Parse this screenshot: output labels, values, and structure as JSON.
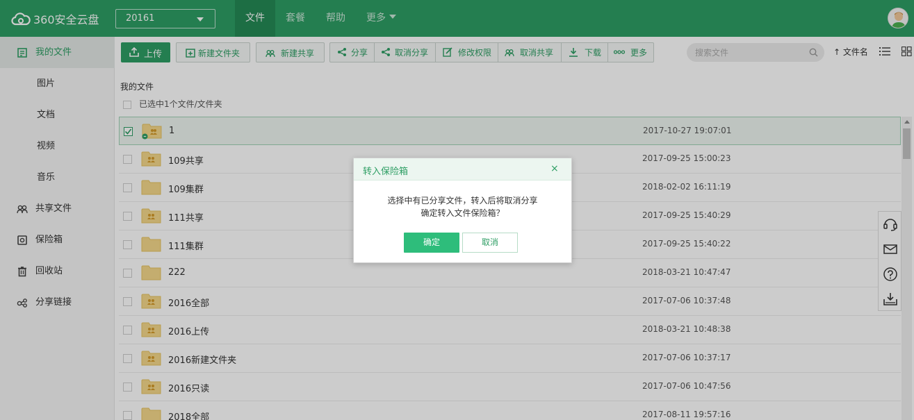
{
  "app": {
    "logo_text": "360安全云盘",
    "account": "20161"
  },
  "nav": [
    {
      "label": "文件"
    },
    {
      "label": "套餐"
    },
    {
      "label": "帮助"
    },
    {
      "label": "更多"
    }
  ],
  "sidebar": {
    "items": [
      {
        "label": "我的文件",
        "icon": "my-files-icon"
      },
      {
        "label": "图片"
      },
      {
        "label": "文档"
      },
      {
        "label": "视频"
      },
      {
        "label": "音乐"
      },
      {
        "label": "共享文件",
        "icon": "users-icon"
      },
      {
        "label": "保险箱",
        "icon": "safe-icon"
      },
      {
        "label": "回收站",
        "icon": "trash-icon"
      },
      {
        "label": "分享链接",
        "icon": "link-icon"
      }
    ]
  },
  "toolbar": {
    "upload": "上传",
    "new_folder": "新建文件夹",
    "new_share": "新建共享",
    "share": "分享",
    "cancel_share": "取消分享",
    "edit_perm": "修改权限",
    "cancel_collab": "取消共享",
    "download": "下载",
    "more": "更多",
    "search_placeholder": "搜索文件",
    "sort_label": "文件名"
  },
  "breadcrumb": "我的文件",
  "selection_info": "已选中1个文件/文件夹",
  "files": [
    {
      "name": "1",
      "date": "2017-10-27 19:07:01",
      "type": "shared-link"
    },
    {
      "name": "109共享",
      "date": "2017-09-25 15:00:23",
      "type": "shared"
    },
    {
      "name": "109集群",
      "date": "2018-02-02 16:11:19",
      "type": "plain"
    },
    {
      "name": "111共享",
      "date": "2017-09-25 15:40:29",
      "type": "shared"
    },
    {
      "name": "111集群",
      "date": "2017-09-25 15:40:22",
      "type": "plain"
    },
    {
      "name": "222",
      "date": "2018-03-21 10:47:47",
      "type": "plain"
    },
    {
      "name": "2016全部",
      "date": "2017-07-06 10:37:48",
      "type": "shared"
    },
    {
      "name": "2016上传",
      "date": "2018-03-21 10:48:38",
      "type": "shared"
    },
    {
      "name": "2016新建文件夹",
      "date": "2017-07-06 10:37:17",
      "type": "shared"
    },
    {
      "name": "2016只读",
      "date": "2017-07-06 10:47:56",
      "type": "shared"
    },
    {
      "name": "2018全部",
      "date": "2017-08-11 19:57:16",
      "type": "plain"
    }
  ],
  "modal": {
    "title": "转入保险箱",
    "line1": "选择中有已分享文件，转入后将取消分享",
    "line2": "确定转入文件保险箱？",
    "ok": "确定",
    "cancel": "取消",
    "close": "×"
  },
  "colors": {
    "brand": "#2e9e64",
    "folder": "#f5d98b"
  }
}
